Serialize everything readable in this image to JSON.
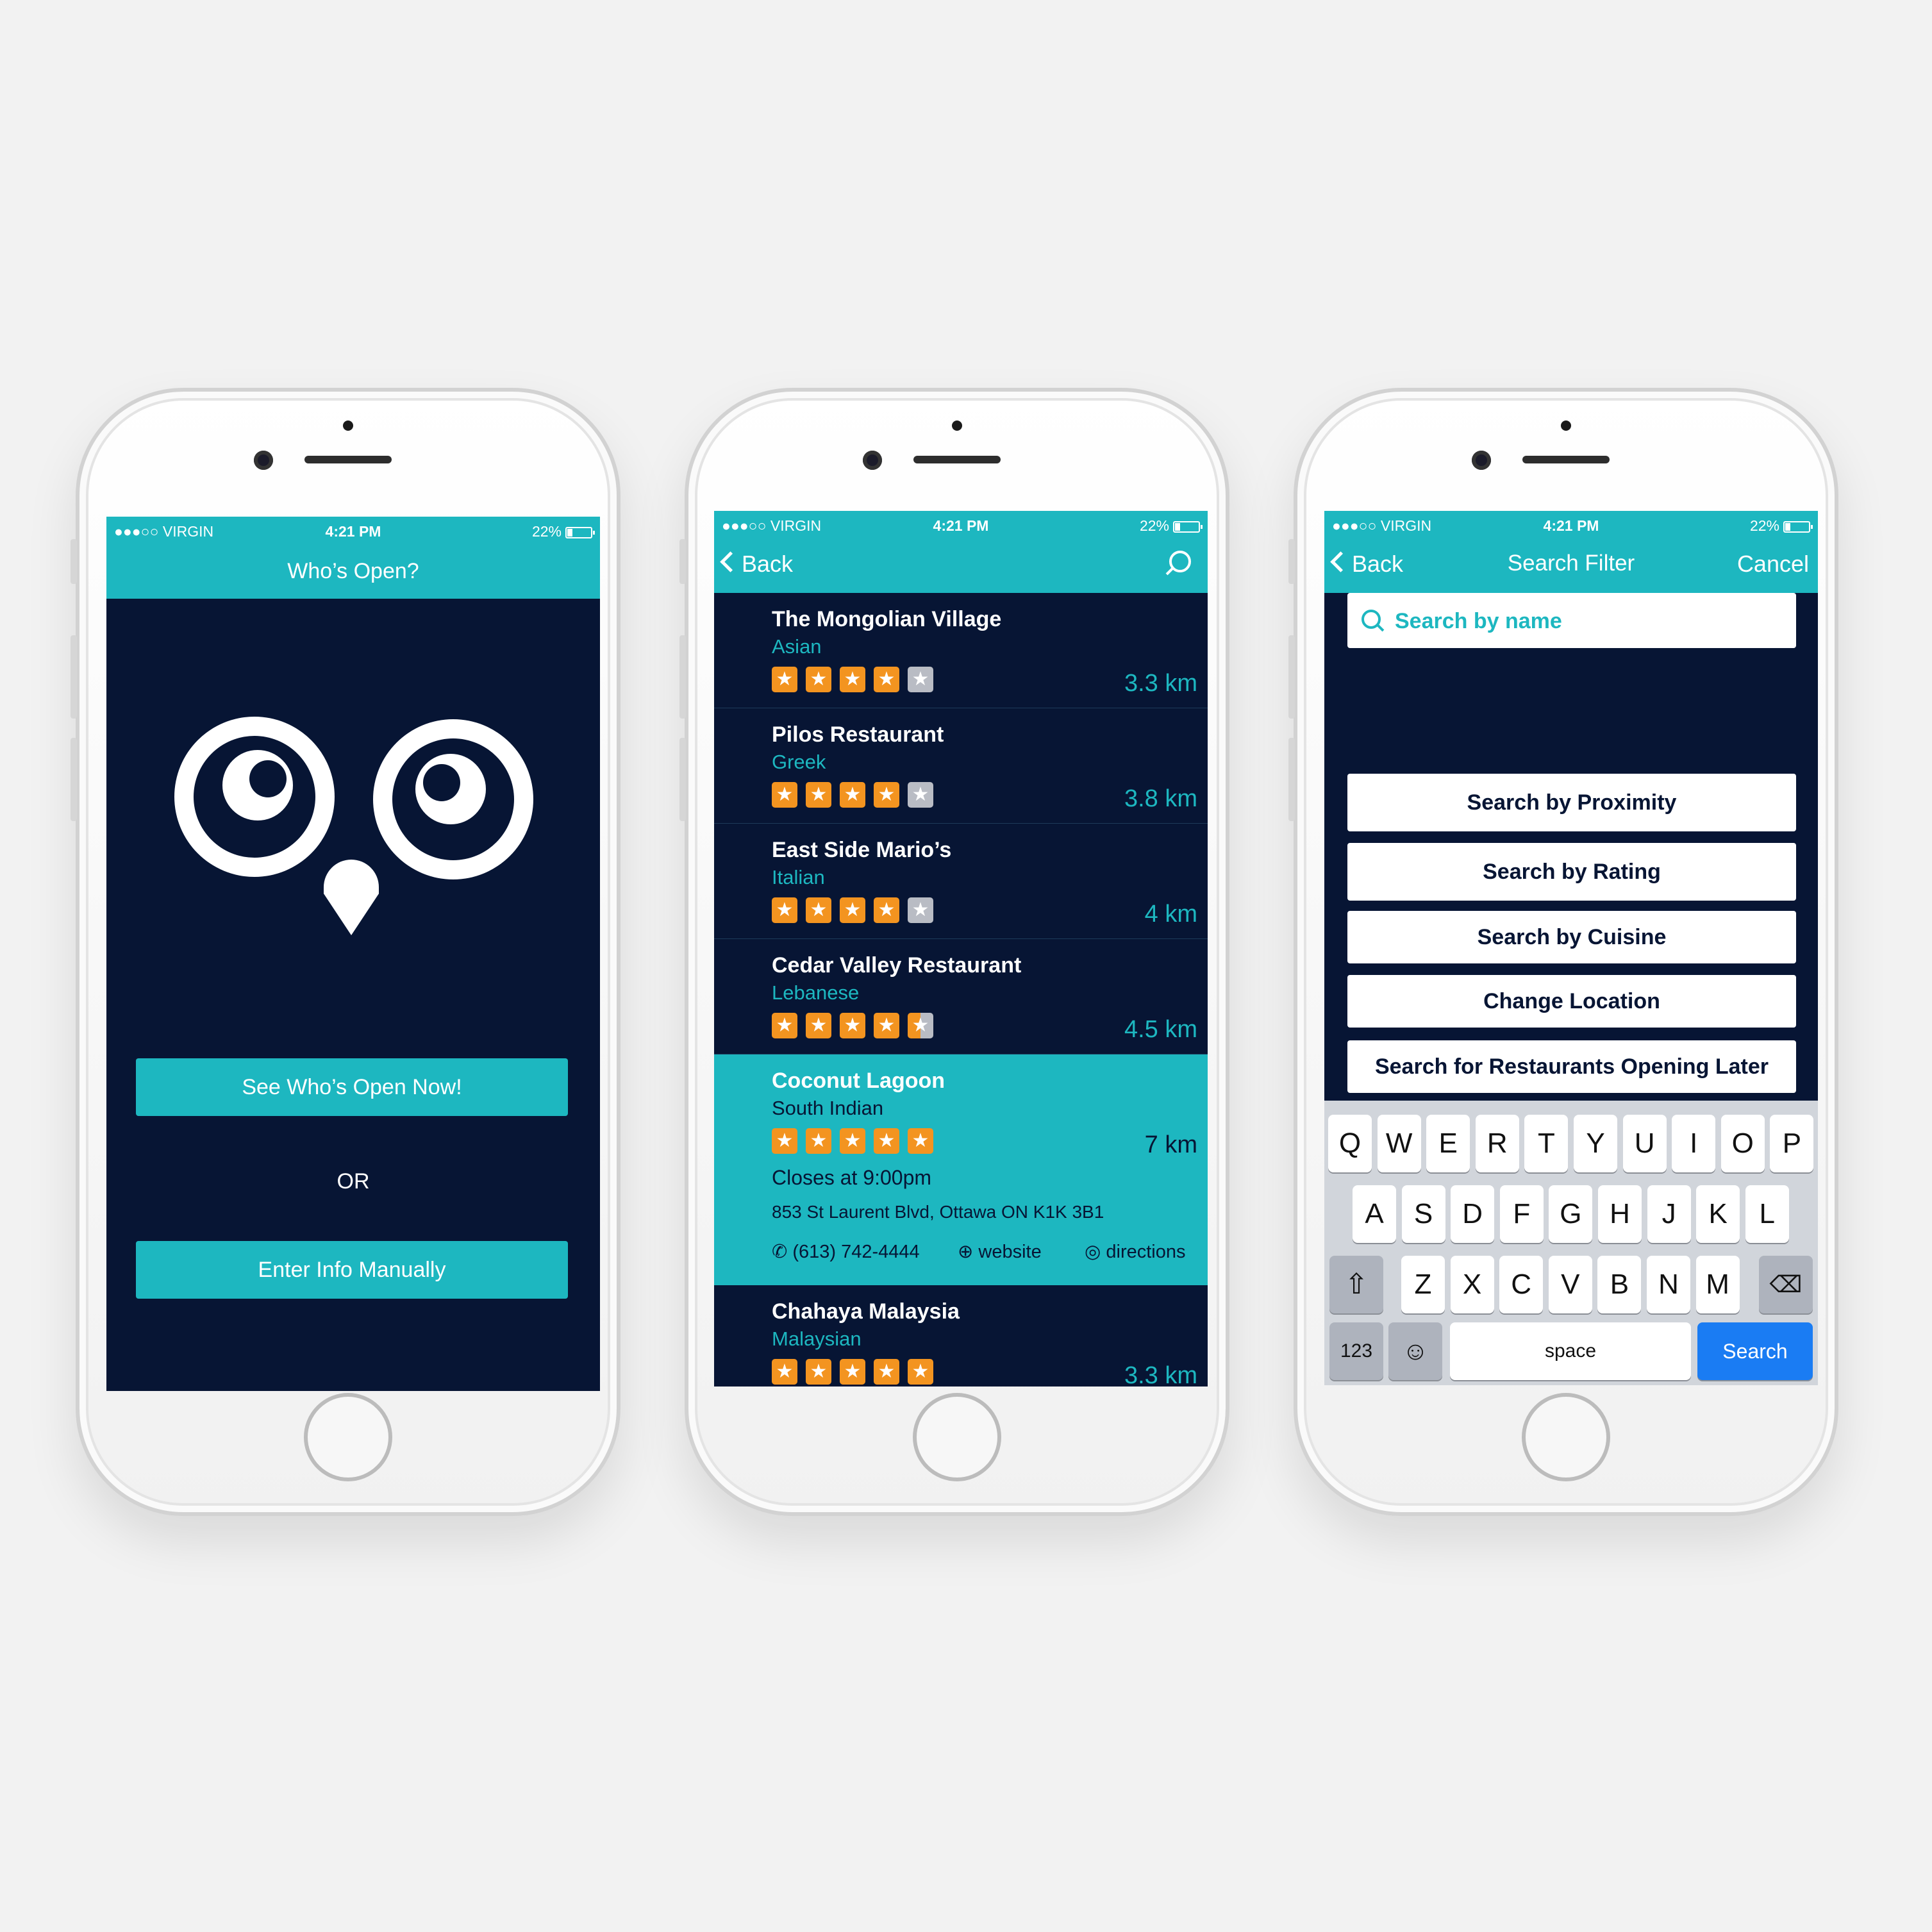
{
  "status_bar": {
    "carrier": "●●●○○ VIRGIN",
    "time": "4:21 PM",
    "battery": "22%"
  },
  "screen1": {
    "title": "Who’s Open?",
    "primary_button": "See Who’s Open Now!",
    "or_label": "OR",
    "secondary_button": "Enter Info Manually"
  },
  "screen2": {
    "back_label": "Back",
    "restaurants": [
      {
        "name": "The Mongolian Village",
        "cuisine": "Asian",
        "rating": 4,
        "distance": "3.3 km"
      },
      {
        "name": "Pilos Restaurant",
        "cuisine": "Greek",
        "rating": 4,
        "distance": "3.8 km"
      },
      {
        "name": "East Side Mario’s",
        "cuisine": "Italian",
        "rating": 4,
        "distance": "4 km"
      },
      {
        "name": "Cedar Valley Restaurant",
        "cuisine": "Lebanese",
        "rating": 4.5,
        "distance": "4.5 km"
      },
      {
        "name": "Coconut Lagoon",
        "cuisine": "South Indian",
        "rating": 5,
        "distance": "7 km",
        "closes": "Closes at 9:00pm",
        "address": "853 St Laurent Blvd, Ottawa ON K1K 3B1",
        "phone": "(613) 742-4444",
        "website": "website",
        "directions": "directions"
      },
      {
        "name": "Chahaya Malaysia",
        "cuisine": "Malaysian",
        "rating": 5,
        "distance": "3.3 km"
      }
    ]
  },
  "screen3": {
    "back_label": "Back",
    "title": "Search Filter",
    "cancel_label": "Cancel",
    "search_placeholder": "Search by name",
    "filters": [
      "Search by Proximity",
      "Search by Rating",
      "Search by Cuisine",
      "Change Location",
      "Search for Restaurants Opening Later"
    ],
    "keyboard": {
      "row1": [
        "Q",
        "W",
        "E",
        "R",
        "T",
        "Y",
        "U",
        "I",
        "O",
        "P"
      ],
      "row2": [
        "A",
        "S",
        "D",
        "F",
        "G",
        "H",
        "J",
        "K",
        "L"
      ],
      "row3": [
        "Z",
        "X",
        "C",
        "V",
        "B",
        "N",
        "M"
      ],
      "numbers_key": "123",
      "space_key": "space",
      "search_key": "Search"
    }
  },
  "colors": {
    "teal": "#1db7c0",
    "navy": "#071534",
    "star": "#f39420",
    "key_blue": "#1a7cf3"
  }
}
